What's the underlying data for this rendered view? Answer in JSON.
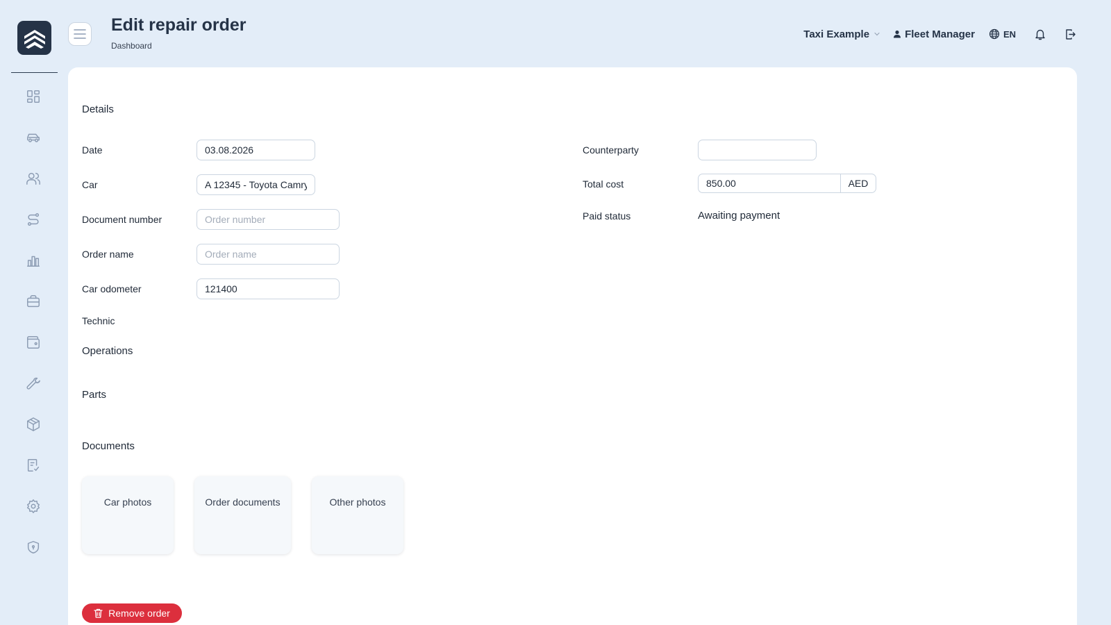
{
  "header": {
    "title": "Edit repair order",
    "breadcrumb": "Dashboard",
    "company": "Taxi Example",
    "user": "Fleet Manager",
    "language": "EN"
  },
  "sidebar": {
    "items": [
      {
        "name": "dashboard-icon"
      },
      {
        "name": "car-icon"
      },
      {
        "name": "users-icon"
      },
      {
        "name": "route-icon"
      },
      {
        "name": "chart-icon"
      },
      {
        "name": "briefcase-icon"
      },
      {
        "name": "wallet-icon"
      },
      {
        "name": "wrench-icon"
      },
      {
        "name": "package-icon"
      },
      {
        "name": "checklist-icon"
      },
      {
        "name": "gear-icon"
      },
      {
        "name": "shield-icon"
      }
    ]
  },
  "form": {
    "details_title": "Details",
    "date": {
      "label": "Date",
      "value": "03.08.2026"
    },
    "car": {
      "label": "Car",
      "value": "A 12345 - Toyota Camry"
    },
    "document_number": {
      "label": "Document number",
      "value": "",
      "placeholder": "Order number"
    },
    "order_name": {
      "label": "Order name",
      "value": "",
      "placeholder": "Order name"
    },
    "car_odometer": {
      "label": "Car odometer",
      "value": "121400"
    },
    "technic": {
      "label": "Technic"
    },
    "counterparty": {
      "label": "Counterparty",
      "value": ""
    },
    "total_cost": {
      "label": "Total cost",
      "value": "850.00",
      "currency": "AED"
    },
    "paid_status": {
      "label": "Paid status",
      "value": "Awaiting payment"
    }
  },
  "sections": {
    "operations": "Operations",
    "parts": "Parts",
    "documents": "Documents"
  },
  "documents": {
    "tiles": [
      "Car photos",
      "Order documents",
      "Other photos"
    ]
  },
  "actions": {
    "remove_label": "Remove order"
  },
  "colors": {
    "background": "#e3edf8",
    "brand_dark": "#253347",
    "danger": "#dc2f3d"
  }
}
